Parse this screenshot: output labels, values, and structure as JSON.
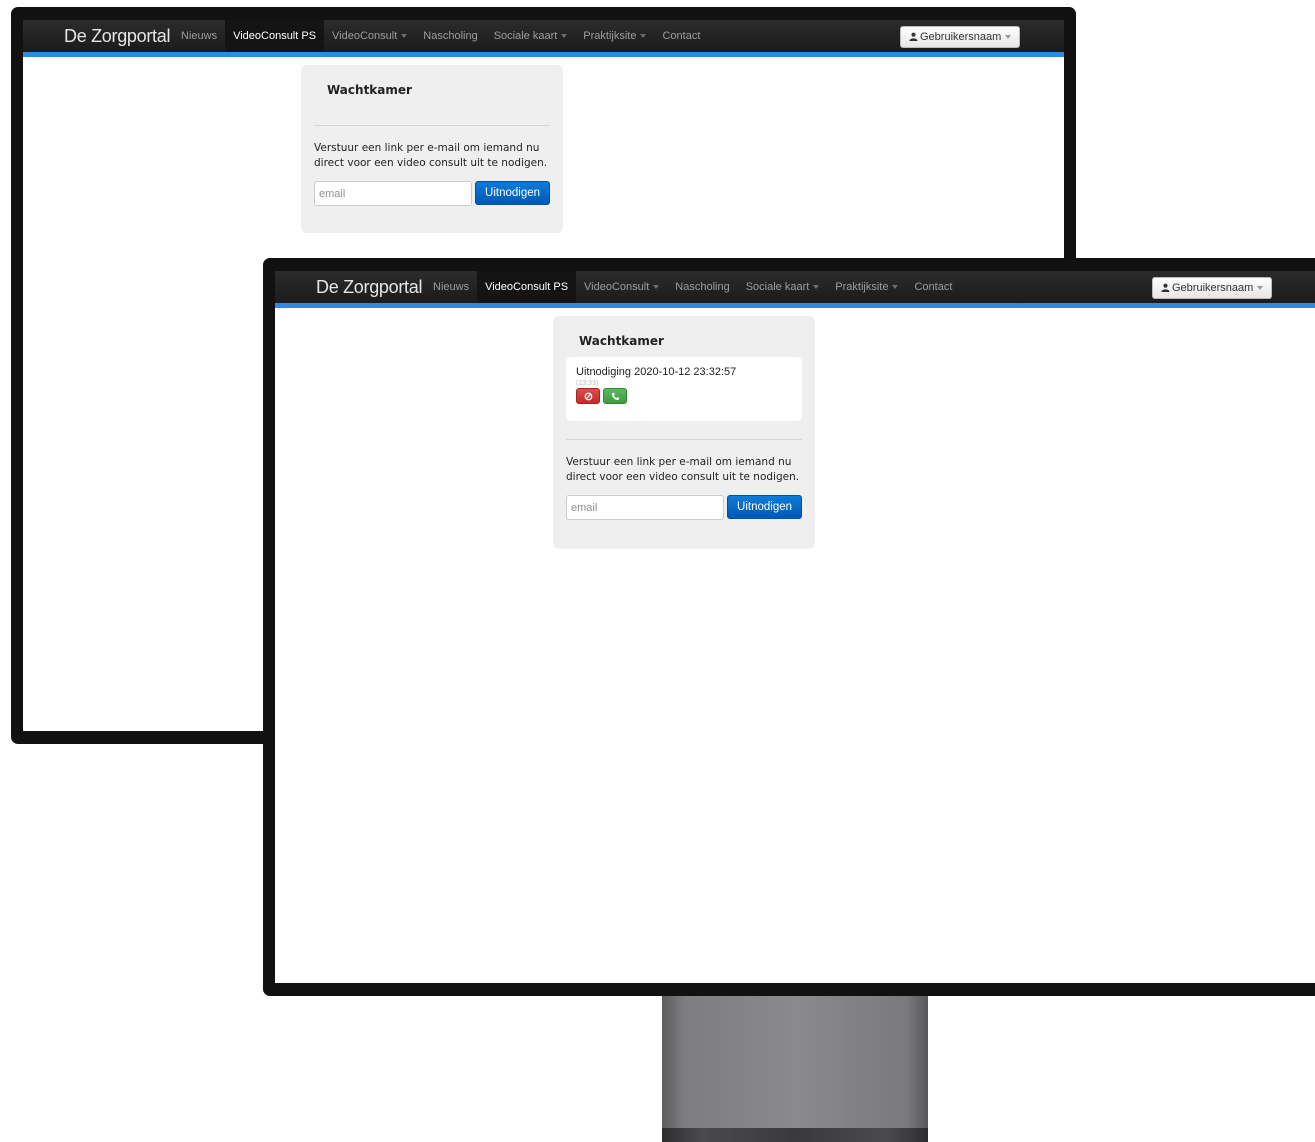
{
  "navbar": {
    "brand": "De Zorgportal",
    "items": [
      {
        "label": "Nieuws",
        "dropdown": false,
        "active": false
      },
      {
        "label": "VideoConsult PS",
        "dropdown": false,
        "active": true
      },
      {
        "label": "VideoConsult",
        "dropdown": true,
        "active": false
      },
      {
        "label": "Nascholing",
        "dropdown": false,
        "active": false
      },
      {
        "label": "Sociale kaart",
        "dropdown": true,
        "active": false
      },
      {
        "label": "Praktijksite",
        "dropdown": true,
        "active": false
      },
      {
        "label": "Contact",
        "dropdown": false,
        "active": false
      }
    ],
    "user_label": "Gebruikersnaam"
  },
  "waiting_room": {
    "title": "Wachtkamer",
    "description": "Verstuur een link per e-mail om iemand nu direct voor een video consult uit te nodigen.",
    "email_placeholder": "email",
    "invite_button": "Uitnodigen"
  },
  "invitation": {
    "label": "Uitnodiging 2020-10-12 23:32:57",
    "time": "(23:33)",
    "cancel_icon": "block-icon",
    "call_icon": "phone-icon"
  },
  "colors": {
    "accent": "#2f8be0",
    "primary_button": "#0068c8",
    "cancel": "#d13b3b",
    "call": "#4cab4c"
  }
}
